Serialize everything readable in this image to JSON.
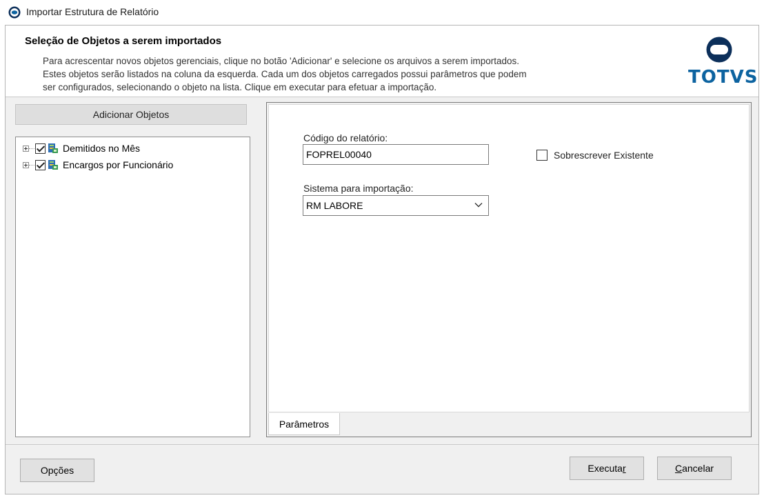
{
  "window": {
    "title": "Importar Estrutura de Relatório"
  },
  "header": {
    "title": "Seleção de Objetos a serem importados",
    "description_lines": [
      "Para acrescentar novos objetos gerenciais, clique no botão 'Adicionar' e selecione os arquivos a serem importados.",
      "Estes objetos serão listados na coluna da esquerda. Cada um dos objetos carregados possui parâmetros que podem",
      "ser configurados, selecionando o objeto na lista. Clique em executar para efetuar a importação."
    ],
    "logo_text": "TOTVS"
  },
  "left": {
    "add_button": "Adicionar Objetos",
    "tree": [
      {
        "label": "Demitidos no Mês",
        "checked": true
      },
      {
        "label": "Encargos por  Funcionário",
        "checked": true
      }
    ]
  },
  "params": {
    "code_label": "Código do relatório:",
    "code_value": "FOPREL00040",
    "overwrite_label": "Sobrescrever Existente",
    "overwrite_checked": false,
    "system_label": "Sistema para importação:",
    "system_value": "RM LABORE",
    "tab_label": "Parâmetros"
  },
  "footer": {
    "options_button": "Opções",
    "execute_button_prefix": "Executa",
    "execute_button_accel": "r",
    "cancel_button_accel": "C",
    "cancel_button_rest": "ancelar"
  },
  "colors": {
    "brand_blue": "#0c63a0",
    "dialog_bg": "#f0f0f0"
  },
  "icons": {
    "app": "totvs-logo-icon",
    "tree_item": "report-object-icon",
    "dropdown": "chevron-down-icon"
  }
}
